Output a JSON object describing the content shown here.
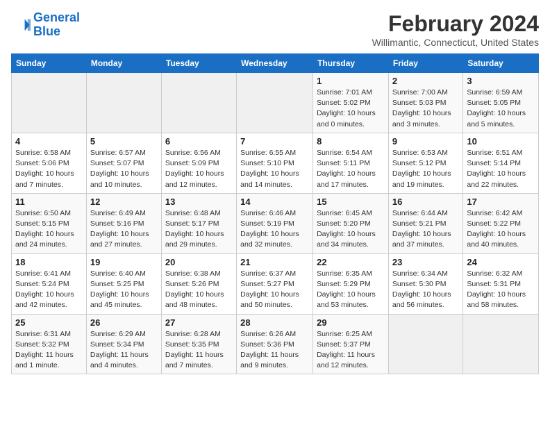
{
  "header": {
    "logo_line1": "General",
    "logo_line2": "Blue",
    "month_title": "February 2024",
    "location": "Willimantic, Connecticut, United States"
  },
  "weekdays": [
    "Sunday",
    "Monday",
    "Tuesday",
    "Wednesday",
    "Thursday",
    "Friday",
    "Saturday"
  ],
  "weeks": [
    [
      {
        "day": "",
        "info": ""
      },
      {
        "day": "",
        "info": ""
      },
      {
        "day": "",
        "info": ""
      },
      {
        "day": "",
        "info": ""
      },
      {
        "day": "1",
        "info": "Sunrise: 7:01 AM\nSunset: 5:02 PM\nDaylight: 10 hours\nand 0 minutes."
      },
      {
        "day": "2",
        "info": "Sunrise: 7:00 AM\nSunset: 5:03 PM\nDaylight: 10 hours\nand 3 minutes."
      },
      {
        "day": "3",
        "info": "Sunrise: 6:59 AM\nSunset: 5:05 PM\nDaylight: 10 hours\nand 5 minutes."
      }
    ],
    [
      {
        "day": "4",
        "info": "Sunrise: 6:58 AM\nSunset: 5:06 PM\nDaylight: 10 hours\nand 7 minutes."
      },
      {
        "day": "5",
        "info": "Sunrise: 6:57 AM\nSunset: 5:07 PM\nDaylight: 10 hours\nand 10 minutes."
      },
      {
        "day": "6",
        "info": "Sunrise: 6:56 AM\nSunset: 5:09 PM\nDaylight: 10 hours\nand 12 minutes."
      },
      {
        "day": "7",
        "info": "Sunrise: 6:55 AM\nSunset: 5:10 PM\nDaylight: 10 hours\nand 14 minutes."
      },
      {
        "day": "8",
        "info": "Sunrise: 6:54 AM\nSunset: 5:11 PM\nDaylight: 10 hours\nand 17 minutes."
      },
      {
        "day": "9",
        "info": "Sunrise: 6:53 AM\nSunset: 5:12 PM\nDaylight: 10 hours\nand 19 minutes."
      },
      {
        "day": "10",
        "info": "Sunrise: 6:51 AM\nSunset: 5:14 PM\nDaylight: 10 hours\nand 22 minutes."
      }
    ],
    [
      {
        "day": "11",
        "info": "Sunrise: 6:50 AM\nSunset: 5:15 PM\nDaylight: 10 hours\nand 24 minutes."
      },
      {
        "day": "12",
        "info": "Sunrise: 6:49 AM\nSunset: 5:16 PM\nDaylight: 10 hours\nand 27 minutes."
      },
      {
        "day": "13",
        "info": "Sunrise: 6:48 AM\nSunset: 5:17 PM\nDaylight: 10 hours\nand 29 minutes."
      },
      {
        "day": "14",
        "info": "Sunrise: 6:46 AM\nSunset: 5:19 PM\nDaylight: 10 hours\nand 32 minutes."
      },
      {
        "day": "15",
        "info": "Sunrise: 6:45 AM\nSunset: 5:20 PM\nDaylight: 10 hours\nand 34 minutes."
      },
      {
        "day": "16",
        "info": "Sunrise: 6:44 AM\nSunset: 5:21 PM\nDaylight: 10 hours\nand 37 minutes."
      },
      {
        "day": "17",
        "info": "Sunrise: 6:42 AM\nSunset: 5:22 PM\nDaylight: 10 hours\nand 40 minutes."
      }
    ],
    [
      {
        "day": "18",
        "info": "Sunrise: 6:41 AM\nSunset: 5:24 PM\nDaylight: 10 hours\nand 42 minutes."
      },
      {
        "day": "19",
        "info": "Sunrise: 6:40 AM\nSunset: 5:25 PM\nDaylight: 10 hours\nand 45 minutes."
      },
      {
        "day": "20",
        "info": "Sunrise: 6:38 AM\nSunset: 5:26 PM\nDaylight: 10 hours\nand 48 minutes."
      },
      {
        "day": "21",
        "info": "Sunrise: 6:37 AM\nSunset: 5:27 PM\nDaylight: 10 hours\nand 50 minutes."
      },
      {
        "day": "22",
        "info": "Sunrise: 6:35 AM\nSunset: 5:29 PM\nDaylight: 10 hours\nand 53 minutes."
      },
      {
        "day": "23",
        "info": "Sunrise: 6:34 AM\nSunset: 5:30 PM\nDaylight: 10 hours\nand 56 minutes."
      },
      {
        "day": "24",
        "info": "Sunrise: 6:32 AM\nSunset: 5:31 PM\nDaylight: 10 hours\nand 58 minutes."
      }
    ],
    [
      {
        "day": "25",
        "info": "Sunrise: 6:31 AM\nSunset: 5:32 PM\nDaylight: 11 hours\nand 1 minute."
      },
      {
        "day": "26",
        "info": "Sunrise: 6:29 AM\nSunset: 5:34 PM\nDaylight: 11 hours\nand 4 minutes."
      },
      {
        "day": "27",
        "info": "Sunrise: 6:28 AM\nSunset: 5:35 PM\nDaylight: 11 hours\nand 7 minutes."
      },
      {
        "day": "28",
        "info": "Sunrise: 6:26 AM\nSunset: 5:36 PM\nDaylight: 11 hours\nand 9 minutes."
      },
      {
        "day": "29",
        "info": "Sunrise: 6:25 AM\nSunset: 5:37 PM\nDaylight: 11 hours\nand 12 minutes."
      },
      {
        "day": "",
        "info": ""
      },
      {
        "day": "",
        "info": ""
      }
    ]
  ]
}
